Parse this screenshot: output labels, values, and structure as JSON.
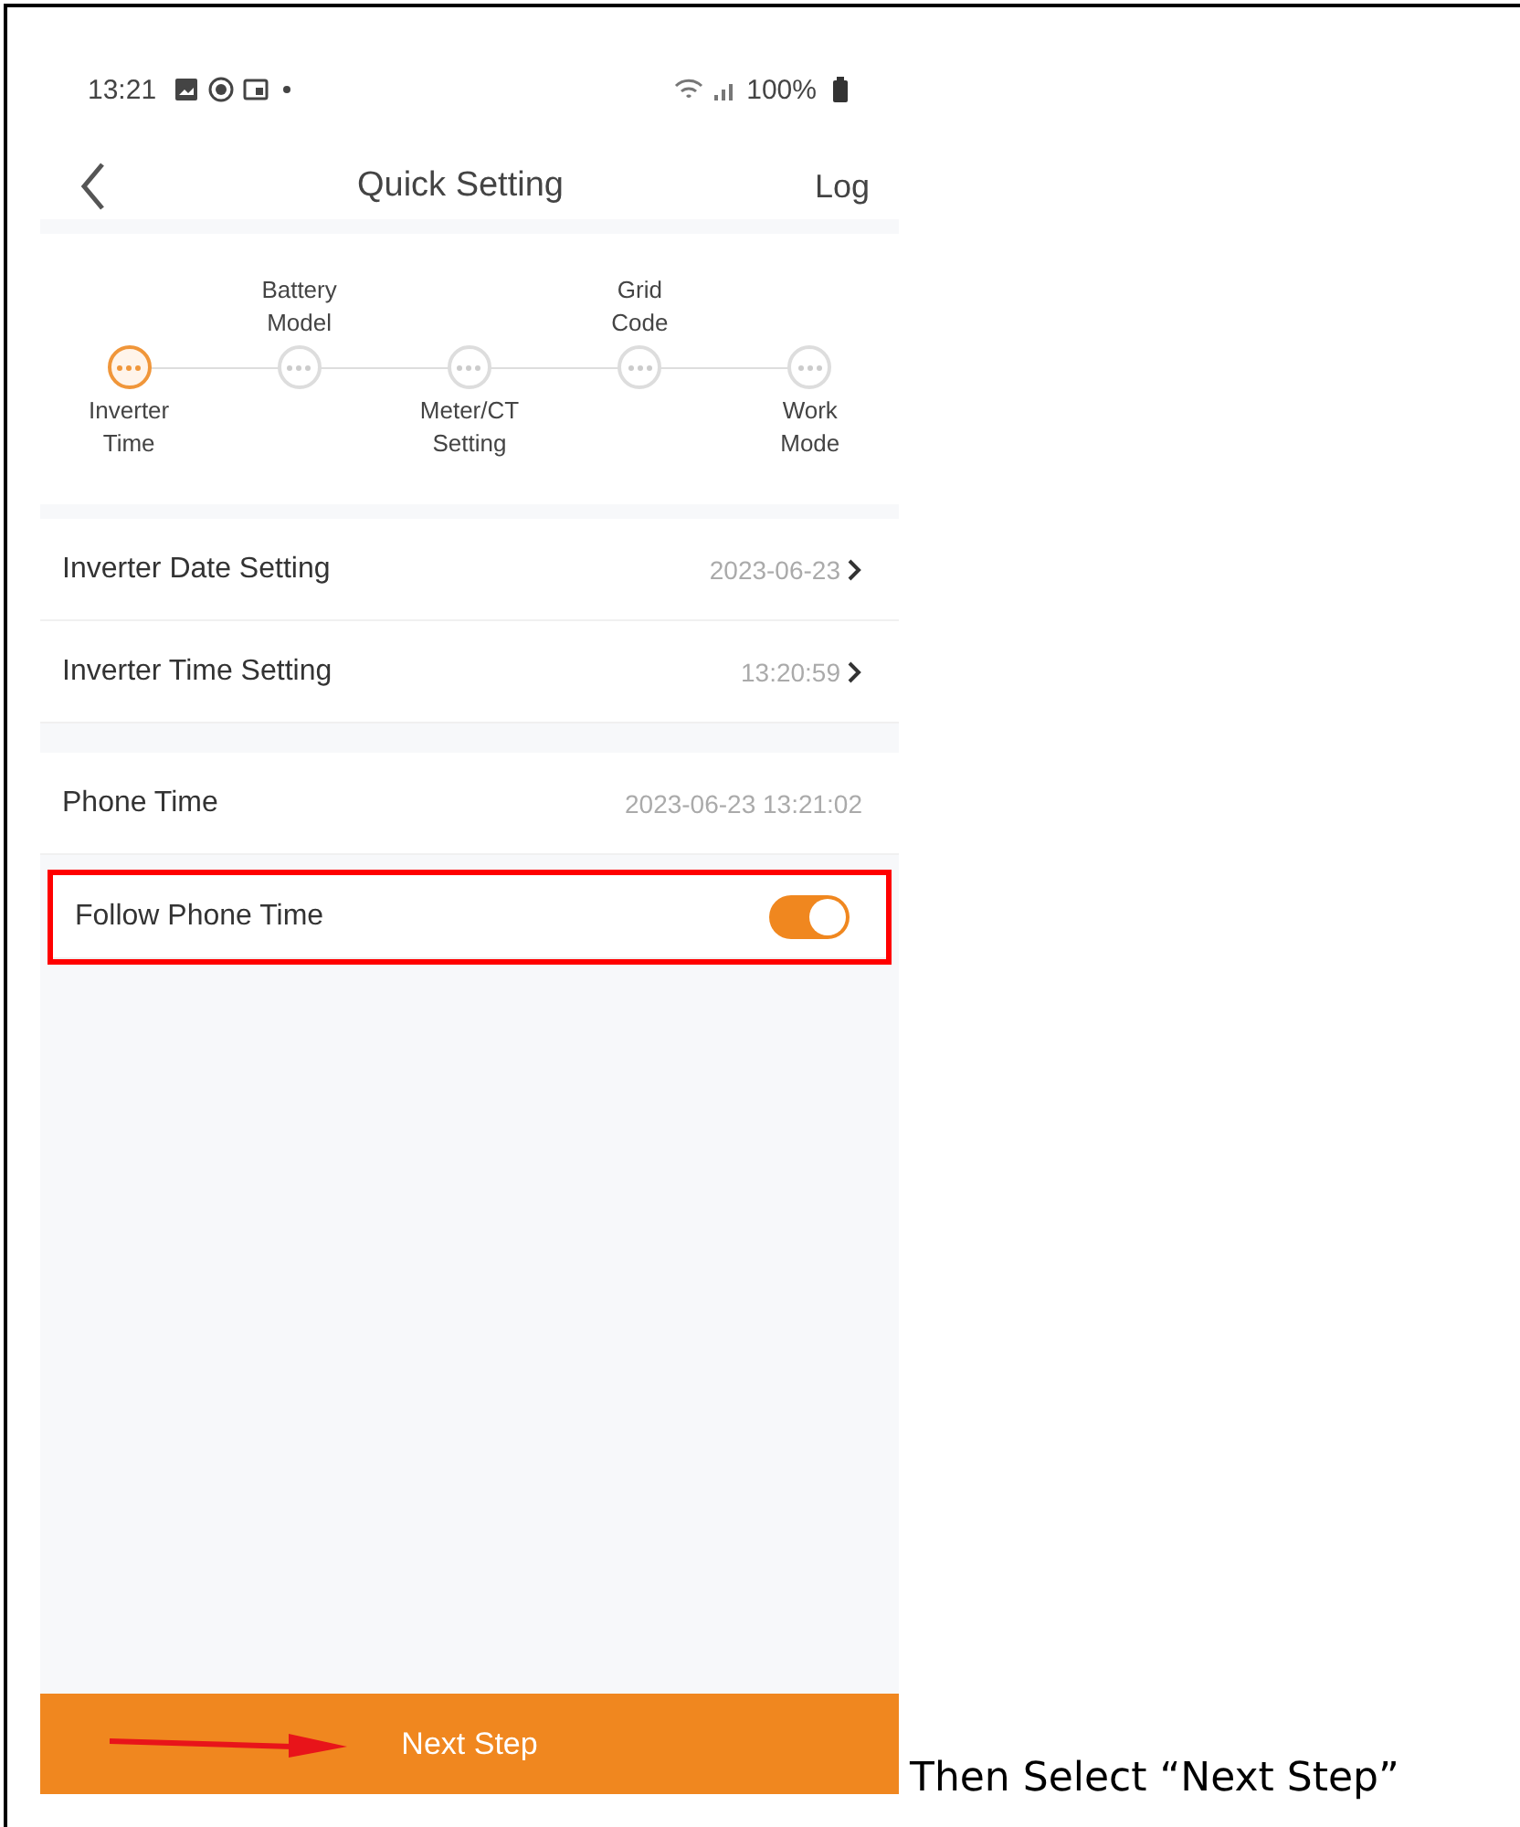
{
  "status_bar": {
    "time": "13:21",
    "battery": "100%"
  },
  "header": {
    "title": "Quick Setting",
    "action": "Log"
  },
  "steps": [
    {
      "label": "Inverter\nTime",
      "selected": true
    },
    {
      "label": "Battery\nModel",
      "selected": false
    },
    {
      "label": "Meter/CT\nSetting",
      "selected": false
    },
    {
      "label": "Grid\nCode",
      "selected": false
    },
    {
      "label": "Work\nMode",
      "selected": false
    }
  ],
  "settings": [
    {
      "kind": "link",
      "label": "Inverter Date Setting",
      "value": "2023-06-23"
    },
    {
      "kind": "link",
      "label": "Inverter Time Setting",
      "value": "13:20:59"
    },
    {
      "kind": "info",
      "label": "Phone Time",
      "value": "2023-06-23 13:21:02"
    },
    {
      "kind": "toggle",
      "label": "Follow Phone Time",
      "on": true,
      "highlighted": true
    }
  ],
  "next_button": {
    "label": "Next Step"
  },
  "caption": "Then Select “Next Step”"
}
